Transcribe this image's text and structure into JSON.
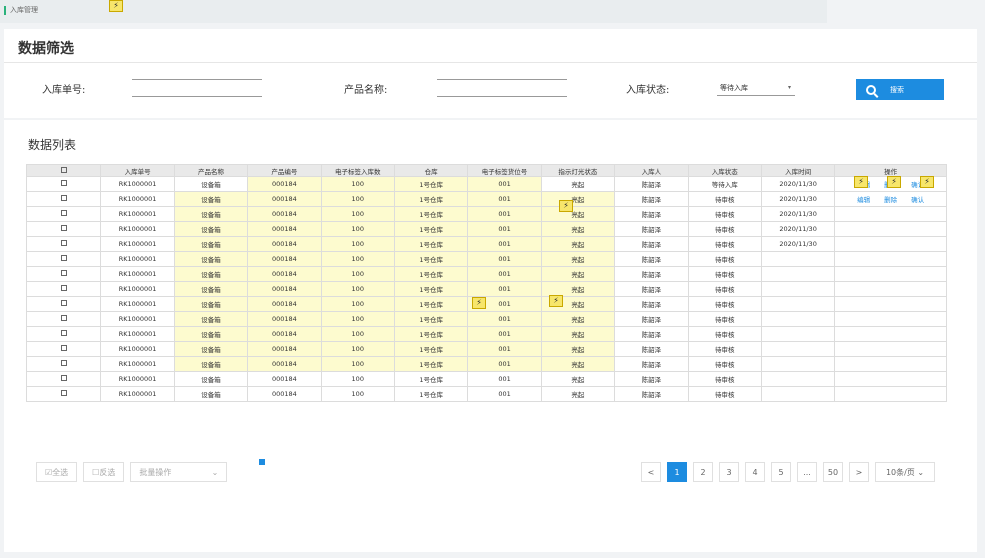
{
  "breadcrumb": "入库管理",
  "filter": {
    "title": "数据筛选",
    "order_label": "入库单号:",
    "product_label": "产品名称:",
    "status_label": "入库状态:",
    "status_value": "等待入库",
    "search_label": "搜索"
  },
  "list": {
    "title": "数据列表",
    "columns": [
      "入库单号",
      "产品名称",
      "产品编号",
      "电子标签入库数",
      "仓库",
      "电子标签货位号",
      "指示灯光状态",
      "入库人",
      "入库状态",
      "入库时间",
      "操作"
    ],
    "rows": [
      {
        "order": "RK1000001",
        "product": "设备箱",
        "code": "000184",
        "count": "100",
        "warehouse": "1号仓库",
        "slot": "001",
        "light": "亮起",
        "person": "陈韶泽",
        "status": "等待入库",
        "time": "2020/11/30",
        "actions": [
          "编辑",
          "删除",
          "确认"
        ]
      },
      {
        "order": "RK1000001",
        "product": "设备箱",
        "code": "000184",
        "count": "100",
        "warehouse": "1号仓库",
        "slot": "001",
        "light": "亮起",
        "person": "陈韶泽",
        "status": "待审核",
        "time": "2020/11/30",
        "actions": [
          "编辑",
          "删除",
          "确认"
        ]
      },
      {
        "order": "RK1000001",
        "product": "设备箱",
        "code": "000184",
        "count": "100",
        "warehouse": "1号仓库",
        "slot": "001",
        "light": "亮起",
        "person": "陈韶泽",
        "status": "待审核",
        "time": "2020/11/30",
        "actions": []
      },
      {
        "order": "RK1000001",
        "product": "设备箱",
        "code": "000184",
        "count": "100",
        "warehouse": "1号仓库",
        "slot": "001",
        "light": "亮起",
        "person": "陈韶泽",
        "status": "待审核",
        "time": "2020/11/30",
        "actions": []
      },
      {
        "order": "RK1000001",
        "product": "设备箱",
        "code": "000184",
        "count": "100",
        "warehouse": "1号仓库",
        "slot": "001",
        "light": "亮起",
        "person": "陈韶泽",
        "status": "待审核",
        "time": "2020/11/30",
        "actions": []
      },
      {
        "order": "RK1000001",
        "product": "设备箱",
        "code": "000184",
        "count": "100",
        "warehouse": "1号仓库",
        "slot": "001",
        "light": "亮起",
        "person": "陈韶泽",
        "status": "待审核",
        "time": "",
        "actions": []
      },
      {
        "order": "RK1000001",
        "product": "设备箱",
        "code": "000184",
        "count": "100",
        "warehouse": "1号仓库",
        "slot": "001",
        "light": "亮起",
        "person": "陈韶泽",
        "status": "待审核",
        "time": "",
        "actions": []
      },
      {
        "order": "RK1000001",
        "product": "设备箱",
        "code": "000184",
        "count": "100",
        "warehouse": "1号仓库",
        "slot": "001",
        "light": "亮起",
        "person": "陈韶泽",
        "status": "待审核",
        "time": "",
        "actions": []
      },
      {
        "order": "RK1000001",
        "product": "设备箱",
        "code": "000184",
        "count": "100",
        "warehouse": "1号仓库",
        "slot": "001",
        "light": "亮起",
        "person": "陈韶泽",
        "status": "待审核",
        "time": "",
        "actions": []
      },
      {
        "order": "RK1000001",
        "product": "设备箱",
        "code": "000184",
        "count": "100",
        "warehouse": "1号仓库",
        "slot": "001",
        "light": "亮起",
        "person": "陈韶泽",
        "status": "待审核",
        "time": "",
        "actions": []
      },
      {
        "order": "RK1000001",
        "product": "设备箱",
        "code": "000184",
        "count": "100",
        "warehouse": "1号仓库",
        "slot": "001",
        "light": "亮起",
        "person": "陈韶泽",
        "status": "待审核",
        "time": "",
        "actions": []
      },
      {
        "order": "RK1000001",
        "product": "设备箱",
        "code": "000184",
        "count": "100",
        "warehouse": "1号仓库",
        "slot": "001",
        "light": "亮起",
        "person": "陈韶泽",
        "status": "待审核",
        "time": "",
        "actions": []
      },
      {
        "order": "RK1000001",
        "product": "设备箱",
        "code": "000184",
        "count": "100",
        "warehouse": "1号仓库",
        "slot": "001",
        "light": "亮起",
        "person": "陈韶泽",
        "status": "待审核",
        "time": "",
        "actions": []
      },
      {
        "order": "RK1000001",
        "product": "设备箱",
        "code": "000184",
        "count": "100",
        "warehouse": "1号仓库",
        "slot": "001",
        "light": "亮起",
        "person": "陈韶泽",
        "status": "待审核",
        "time": "",
        "actions": []
      },
      {
        "order": "RK1000001",
        "product": "设备箱",
        "code": "000184",
        "count": "100",
        "warehouse": "1号仓库",
        "slot": "001",
        "light": "亮起",
        "person": "陈韶泽",
        "status": "待审核",
        "time": "",
        "actions": []
      }
    ]
  },
  "footer": {
    "select_all": "全选",
    "invert": "反选",
    "batch_placeholder": "批量操作",
    "pages": [
      "1",
      "2",
      "3",
      "4",
      "5",
      "...",
      "50"
    ],
    "prev": "<",
    "next": ">",
    "page_size": "10条/页"
  },
  "colors": {
    "accent": "#1d8ce0",
    "highlight": "#fdfbcf",
    "marker": "#f7e66b"
  },
  "icons": [
    "lightning-icon",
    "search-icon",
    "checkbox-icon"
  ]
}
